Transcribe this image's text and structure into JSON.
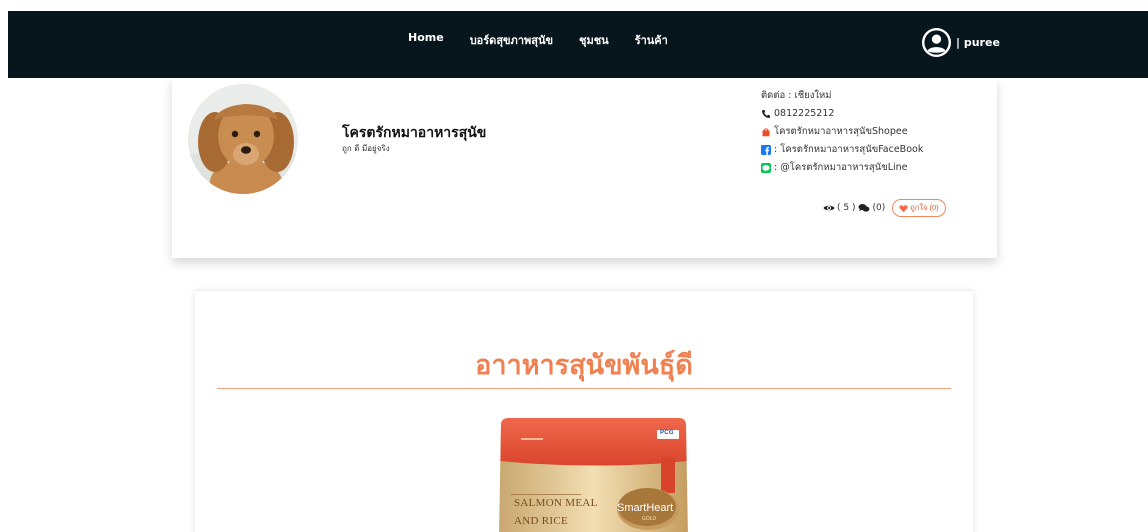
{
  "nav": {
    "items": [
      {
        "label": "Home"
      },
      {
        "label": "บอร์ดสุขภาพสุนัข"
      },
      {
        "label": "ชุมชน"
      },
      {
        "label": "ร้านค้า"
      }
    ],
    "user_label": "| puree",
    "user_icon": "user-circle-icon"
  },
  "profile": {
    "name": "โครตรักหมาอาหารสุนัข",
    "tagline": "ถูก ดี มีอยู่จริง",
    "contact": {
      "location": "ติดต่อ : เชียงใหม่",
      "phone": "0812225212",
      "shopee": "โครตรักหมาอาหารสุนัขShopee",
      "facebook": ": โครตรักหมาอาหารสุนัขFaceBook",
      "line": ": @โครตรักหมาอาหารสุนัขLine"
    },
    "stats": {
      "views": "( 5 )",
      "comments": "(0)",
      "like_label": "ถูกใจ (0)"
    }
  },
  "article": {
    "title": "อาาหารสุนัขพันธุ์ดี",
    "product": {
      "tag": "PCG",
      "line1": "SALMON MEAL",
      "line2": "AND RICE",
      "brand": "SmartHeart",
      "brand_sub": "GOLD"
    }
  },
  "colors": {
    "navbar": "#07161d",
    "accent": "#f08050",
    "shopee": "#ee4d2d",
    "facebook": "#1877f2",
    "line": "#06c755"
  }
}
